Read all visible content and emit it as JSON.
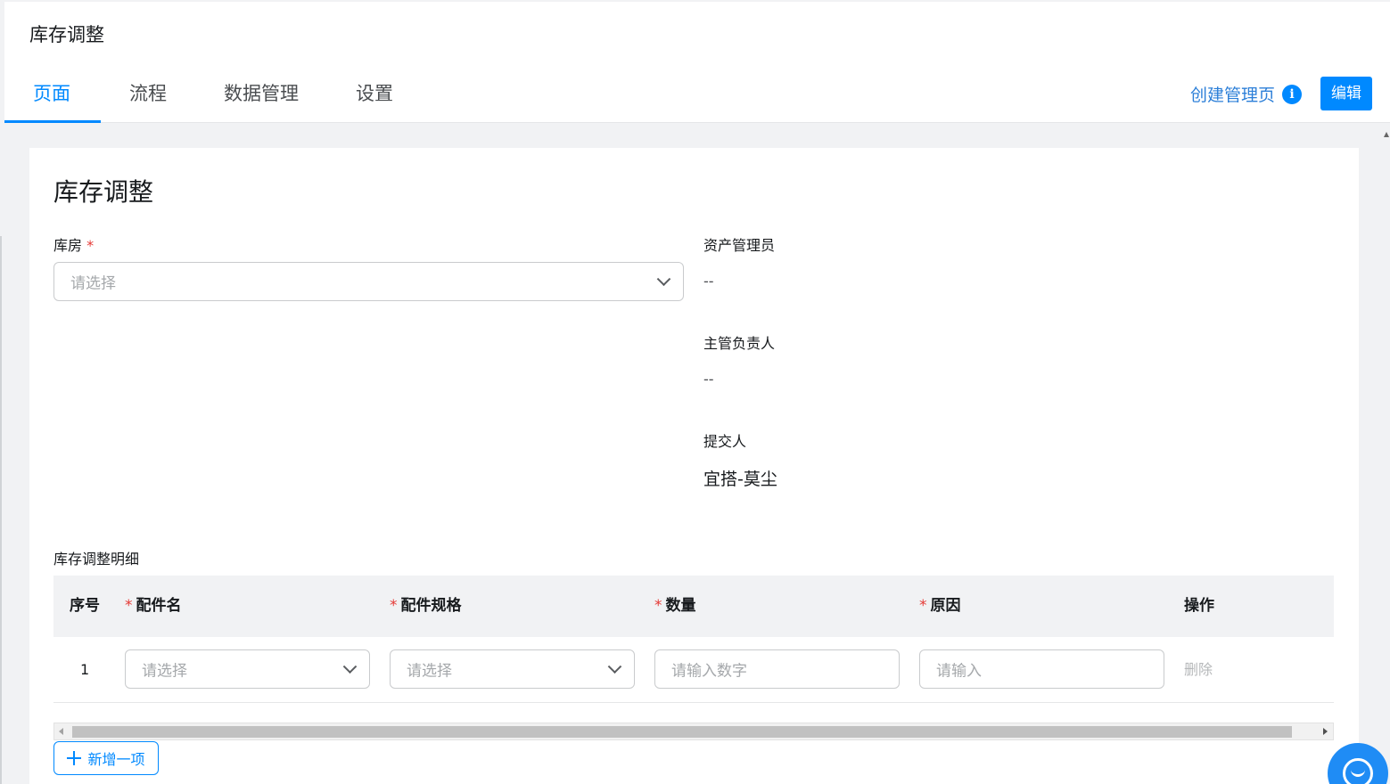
{
  "header": {
    "app_title": "库存调整",
    "tabs": [
      {
        "label": "页面",
        "active": true
      },
      {
        "label": "流程",
        "active": false
      },
      {
        "label": "数据管理",
        "active": false
      },
      {
        "label": "设置",
        "active": false
      }
    ],
    "create_manage_page_label": "创建管理页",
    "info_icon": "info-icon",
    "edit_label": "编辑"
  },
  "form": {
    "title": "库存调整",
    "warehouse": {
      "label": "库房",
      "required_mark": "*",
      "placeholder": "请选择"
    },
    "asset_manager": {
      "label": "资产管理员",
      "value": "--"
    },
    "supervisor": {
      "label": "主管负责人",
      "value": "--"
    },
    "submitter": {
      "label": "提交人",
      "value": "宜搭-莫尘"
    }
  },
  "detail": {
    "section_label": "库存调整明细",
    "columns": [
      {
        "label": "序号",
        "required": false
      },
      {
        "label": "配件名",
        "required": true
      },
      {
        "label": "配件规格",
        "required": true
      },
      {
        "label": "数量",
        "required": true
      },
      {
        "label": "原因",
        "required": true
      },
      {
        "label": "操作",
        "required": false
      }
    ],
    "required_mark": "*",
    "rows": [
      {
        "index": "1",
        "part_name_placeholder": "请选择",
        "spec_placeholder": "请选择",
        "quantity_placeholder": "请输入数字",
        "reason_placeholder": "请输入",
        "delete_label": "删除"
      }
    ],
    "add_item_label": "新增一项"
  },
  "colors": {
    "accent": "#0089ff",
    "required": "#e53935",
    "link": "#2c7fd8",
    "placeholder": "#a5a8ab",
    "disabled": "#b6b8ba"
  },
  "icons": {
    "chevron": "chevron-down-icon",
    "plus": "plus-icon",
    "help": "customer-service-icon"
  }
}
